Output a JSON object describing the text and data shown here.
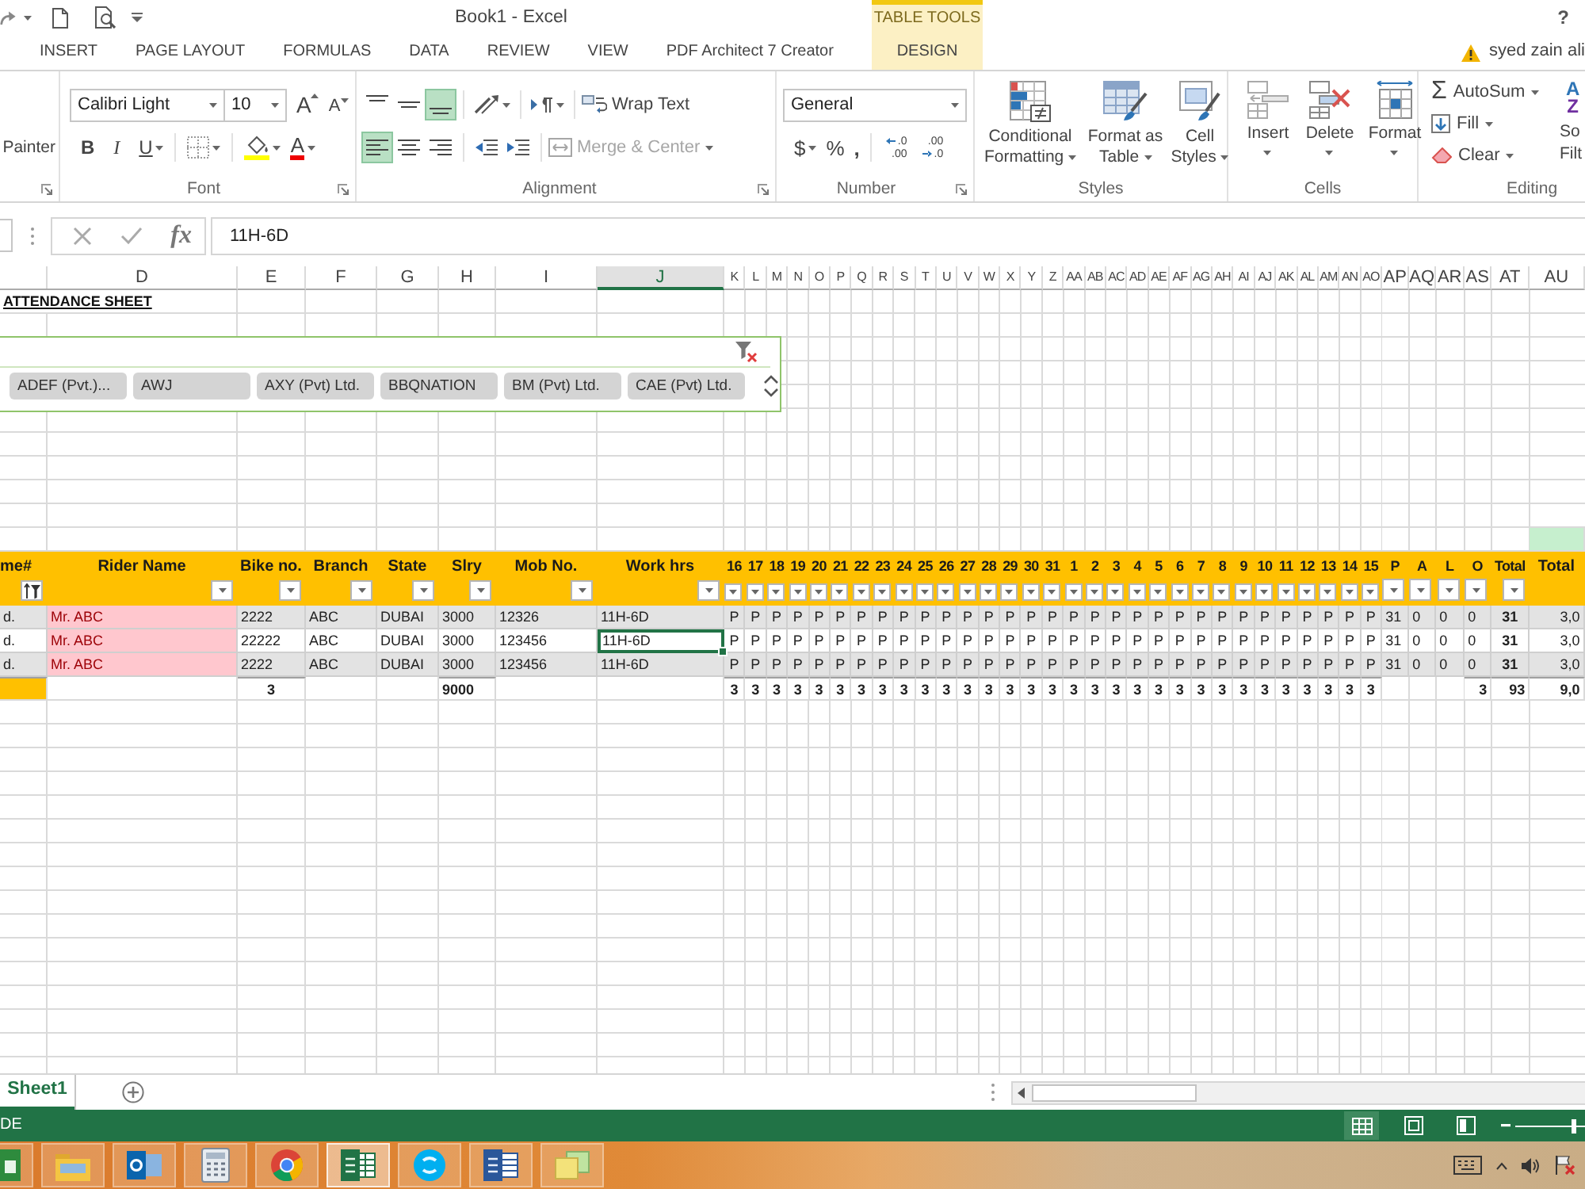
{
  "title_bar": {
    "title": "Book1 - Excel",
    "context_group": "TABLE TOOLS",
    "help": "?"
  },
  "tabs": [
    {
      "label": "INSERT",
      "kind": "standard",
      "selected": false
    },
    {
      "label": "PAGE LAYOUT",
      "kind": "standard",
      "selected": false
    },
    {
      "label": "FORMULAS",
      "kind": "standard",
      "selected": false
    },
    {
      "label": "DATA",
      "kind": "standard",
      "selected": false
    },
    {
      "label": "REVIEW",
      "kind": "standard",
      "selected": false
    },
    {
      "label": "VIEW",
      "kind": "standard",
      "selected": false
    },
    {
      "label": "PDF Architect 7 Creator",
      "kind": "standard",
      "selected": false
    },
    {
      "label": "DESIGN",
      "kind": "contextual",
      "selected": false
    }
  ],
  "account": {
    "name": "syed zain ali",
    "warning": true
  },
  "ribbon": {
    "clipboard": {
      "format_painter": "Painter"
    },
    "font": {
      "label": "Font",
      "font_name": "Calibri Light",
      "font_size": "10",
      "grow": "A",
      "shrink": "A",
      "bold": "B",
      "italic": "I",
      "underline": "U",
      "font_color": "A"
    },
    "alignment": {
      "label": "Alignment",
      "vertical": [
        {
          "selected": false
        },
        {
          "selected": false
        },
        {
          "selected": true
        }
      ],
      "horizontal": [
        {
          "selected": true
        },
        {
          "selected": false
        },
        {
          "selected": false
        }
      ],
      "wrap_text": "Wrap Text",
      "merge": {
        "label": "Merge & Center",
        "disabled": true
      }
    },
    "number": {
      "label": "Number",
      "format": "General",
      "currency": "$",
      "percent": "%",
      "comma": ",",
      "decimals": [
        {
          "top": ".0",
          "bottom": ".00"
        },
        {
          "top": ".00",
          "bottom": ".0"
        }
      ]
    },
    "styles": {
      "label": "Styles",
      "buttons": [
        {
          "label": "Conditional Formatting",
          "kind": "conditional"
        },
        {
          "label": "Format as Table",
          "kind": "table"
        },
        {
          "label": "Cell Styles",
          "kind": "cell"
        }
      ]
    },
    "cells": {
      "label": "Cells",
      "buttons": [
        {
          "label": "Insert",
          "kind": "insert"
        },
        {
          "label": "Delete",
          "kind": "delete"
        },
        {
          "label": "Format",
          "kind": "format"
        }
      ]
    },
    "editing": {
      "label": "Editing",
      "buttons": [
        {
          "label": "AutoSum",
          "kind": "sum",
          "symbol": "Σ"
        },
        {
          "label": "Fill",
          "kind": "fill"
        },
        {
          "label": "Clear",
          "kind": "clear"
        }
      ],
      "sort_letters": [
        "A",
        "Z"
      ],
      "sort_label": [
        "So",
        "Filt"
      ]
    }
  },
  "formula_bar": {
    "function": "fx",
    "value": "11H-6D"
  },
  "sheet": {
    "columns": [
      {
        "letter": "D",
        "selected": false
      },
      {
        "letter": "E",
        "selected": false
      },
      {
        "letter": "F",
        "selected": false
      },
      {
        "letter": "G",
        "selected": false
      },
      {
        "letter": "H",
        "selected": false
      },
      {
        "letter": "I",
        "selected": false
      },
      {
        "letter": "J",
        "selected": true
      },
      {
        "letter": "K",
        "selected": false
      },
      {
        "letter": "L",
        "selected": false
      },
      {
        "letter": "M",
        "selected": false
      },
      {
        "letter": "N",
        "selected": false
      },
      {
        "letter": "O",
        "selected": false
      },
      {
        "letter": "P",
        "selected": false
      },
      {
        "letter": "Q",
        "selected": false
      },
      {
        "letter": "R",
        "selected": false
      },
      {
        "letter": "S",
        "selected": false
      },
      {
        "letter": "T",
        "selected": false
      },
      {
        "letter": "U",
        "selected": false
      },
      {
        "letter": "V",
        "selected": false
      },
      {
        "letter": "W",
        "selected": false
      },
      {
        "letter": "X",
        "selected": false
      },
      {
        "letter": "Y",
        "selected": false
      },
      {
        "letter": "Z",
        "selected": false
      },
      {
        "letter": "AA",
        "selected": false
      },
      {
        "letter": "AB",
        "selected": false
      },
      {
        "letter": "AC",
        "selected": false
      },
      {
        "letter": "AD",
        "selected": false
      },
      {
        "letter": "AE",
        "selected": false
      },
      {
        "letter": "AF",
        "selected": false
      },
      {
        "letter": "AG",
        "selected": false
      },
      {
        "letter": "AH",
        "selected": false
      },
      {
        "letter": "AI",
        "selected": false
      },
      {
        "letter": "AJ",
        "selected": false
      },
      {
        "letter": "AK",
        "selected": false
      },
      {
        "letter": "AL",
        "selected": false
      },
      {
        "letter": "AM",
        "selected": false
      },
      {
        "letter": "AN",
        "selected": false
      },
      {
        "letter": "AO",
        "selected": false
      },
      {
        "letter": "AP",
        "selected": false
      },
      {
        "letter": "AQ",
        "selected": false
      },
      {
        "letter": "AR",
        "selected": false
      },
      {
        "letter": "AS",
        "selected": false
      },
      {
        "letter": "AT",
        "selected": false
      },
      {
        "letter": "AU",
        "selected": false
      }
    ],
    "title": "ATTENDANCE SHEET",
    "slicer": {
      "items": [
        "ADEF (Pvt.)...",
        "AWJ",
        "AXY (Pvt) Ltd.",
        "BBQNATION",
        "BM (Pvt) Ltd.",
        "CAE (Pvt) Ltd."
      ]
    },
    "table": {
      "headers": [
        {
          "text": "me#",
          "kind": "filtered",
          "highlighted": false
        },
        {
          "text": "Rider Name",
          "kind": "dropdown",
          "highlighted": true
        },
        {
          "text": "Bike no.",
          "kind": "dropdown",
          "highlighted": false
        },
        {
          "text": "Branch",
          "kind": "dropdown",
          "highlighted": false
        },
        {
          "text": "State",
          "kind": "dropdown",
          "highlighted": false
        },
        {
          "text": "Slry",
          "kind": "dropdown",
          "highlighted": false
        },
        {
          "text": "Mob No.",
          "kind": "dropdown",
          "highlighted": false
        },
        {
          "text": "Work hrs",
          "kind": "dropdown",
          "highlighted": false
        },
        {
          "text": "16",
          "kind": "dropdown",
          "highlighted": false
        },
        {
          "text": "17",
          "kind": "dropdown",
          "highlighted": false
        },
        {
          "text": "18",
          "kind": "dropdown",
          "highlighted": false
        },
        {
          "text": "19",
          "kind": "dropdown",
          "highlighted": false
        },
        {
          "text": "20",
          "kind": "dropdown",
          "highlighted": false
        },
        {
          "text": "21",
          "kind": "dropdown",
          "highlighted": false
        },
        {
          "text": "22",
          "kind": "dropdown",
          "highlighted": false
        },
        {
          "text": "23",
          "kind": "dropdown",
          "highlighted": false
        },
        {
          "text": "24",
          "kind": "dropdown",
          "highlighted": false
        },
        {
          "text": "25",
          "kind": "dropdown",
          "highlighted": false
        },
        {
          "text": "26",
          "kind": "dropdown",
          "highlighted": false
        },
        {
          "text": "27",
          "kind": "dropdown",
          "highlighted": false
        },
        {
          "text": "28",
          "kind": "dropdown",
          "highlighted": false
        },
        {
          "text": "29",
          "kind": "dropdown",
          "highlighted": false
        },
        {
          "text": "30",
          "kind": "dropdown",
          "highlighted": false
        },
        {
          "text": "31",
          "kind": "dropdown",
          "highlighted": false
        },
        {
          "text": "1",
          "kind": "dropdown",
          "highlighted": false
        },
        {
          "text": "2",
          "kind": "dropdown",
          "highlighted": false
        },
        {
          "text": "3",
          "kind": "dropdown",
          "highlighted": false
        },
        {
          "text": "4",
          "kind": "dropdown",
          "highlighted": false
        },
        {
          "text": "5",
          "kind": "dropdown",
          "highlighted": false
        },
        {
          "text": "6",
          "kind": "dropdown",
          "highlighted": false
        },
        {
          "text": "7",
          "kind": "dropdown",
          "highlighted": false
        },
        {
          "text": "8",
          "kind": "dropdown",
          "highlighted": false
        },
        {
          "text": "9",
          "kind": "dropdown",
          "highlighted": false
        },
        {
          "text": "10",
          "kind": "dropdown",
          "highlighted": false
        },
        {
          "text": "11",
          "kind": "dropdown",
          "highlighted": false
        },
        {
          "text": "12",
          "kind": "dropdown",
          "highlighted": false
        },
        {
          "text": "13",
          "kind": "dropdown",
          "highlighted": false
        },
        {
          "text": "14",
          "kind": "dropdown",
          "highlighted": false
        },
        {
          "text": "15",
          "kind": "dropdown",
          "highlighted": false
        },
        {
          "text": "P",
          "kind": "dropdown",
          "highlighted": false
        },
        {
          "text": "A",
          "kind": "dropdown",
          "highlighted": false
        },
        {
          "text": "L",
          "kind": "dropdown",
          "highlighted": false
        },
        {
          "text": "O",
          "kind": "dropdown",
          "highlighted": false
        },
        {
          "text": "Total",
          "kind": "dropdown",
          "highlighted": false
        },
        {
          "text": "Total",
          "kind": "plain",
          "highlighted": false
        }
      ],
      "rows": [
        {
          "shaded": true,
          "selected": false,
          "cells": [
            "d.",
            "Mr. ABC",
            "2222",
            "ABC",
            "DUBAI",
            "3000",
            "12326",
            "11H-6D",
            "P",
            "P",
            "P",
            "P",
            "P",
            "P",
            "P",
            "P",
            "P",
            "P",
            "P",
            "P",
            "P",
            "P",
            "P",
            "P",
            "P",
            "P",
            "P",
            "P",
            "P",
            "P",
            "P",
            "P",
            "P",
            "P",
            "P",
            "P",
            "P",
            "P",
            "P",
            "31",
            "0",
            "0",
            "0",
            "31",
            "3,0"
          ]
        },
        {
          "shaded": false,
          "selected": true,
          "cells": [
            "d.",
            "Mr. ABC",
            "22222",
            "ABC",
            "DUBAI",
            "3000",
            "123456",
            "11H-6D",
            "P",
            "P",
            "P",
            "P",
            "P",
            "P",
            "P",
            "P",
            "P",
            "P",
            "P",
            "P",
            "P",
            "P",
            "P",
            "P",
            "P",
            "P",
            "P",
            "P",
            "P",
            "P",
            "P",
            "P",
            "P",
            "P",
            "P",
            "P",
            "P",
            "P",
            "P",
            "31",
            "0",
            "0",
            "0",
            "31",
            "3,0"
          ]
        },
        {
          "shaded": true,
          "selected": false,
          "cells": [
            "d.",
            "Mr. ABC",
            "2222",
            "ABC",
            "DUBAI",
            "3000",
            "123456",
            "11H-6D",
            "P",
            "P",
            "P",
            "P",
            "P",
            "P",
            "P",
            "P",
            "P",
            "P",
            "P",
            "P",
            "P",
            "P",
            "P",
            "P",
            "P",
            "P",
            "P",
            "P",
            "P",
            "P",
            "P",
            "P",
            "P",
            "P",
            "P",
            "P",
            "P",
            "P",
            "P",
            "31",
            "0",
            "0",
            "0",
            "31",
            "3,0"
          ]
        }
      ],
      "totals": {
        "bike_no": "3",
        "slry": "9000",
        "days": [
          "3",
          "3",
          "3",
          "3",
          "3",
          "3",
          "3",
          "3",
          "3",
          "3",
          "3",
          "3",
          "3",
          "3",
          "3",
          "3",
          "3",
          "3",
          "3",
          "3",
          "3",
          "3",
          "3",
          "3",
          "3",
          "3",
          "3",
          "3",
          "3",
          "3",
          "3"
        ],
        "o": "3",
        "total": "93",
        "second_total": "9,0"
      }
    }
  },
  "sheet_tabs": [
    {
      "label": "Sheet1",
      "selected": true
    }
  ],
  "status_bar": {
    "mode": "DE",
    "views": [
      {
        "kind": "normal",
        "selected": true
      },
      {
        "kind": "page_layout",
        "selected": false
      },
      {
        "kind": "page_break",
        "selected": false
      }
    ],
    "zoom": {
      "level": 0.85
    }
  },
  "taskbar": {
    "apps": [
      {
        "kind": "store",
        "selected": false
      },
      {
        "kind": "explorer",
        "selected": false
      },
      {
        "kind": "mail",
        "selected": false
      },
      {
        "kind": "calculator",
        "selected": false
      },
      {
        "kind": "browser",
        "selected": false
      },
      {
        "kind": "spreadsheet",
        "selected": true
      },
      {
        "kind": "chat",
        "selected": false
      },
      {
        "kind": "document",
        "selected": false
      },
      {
        "kind": "notes",
        "selected": false
      }
    ]
  }
}
